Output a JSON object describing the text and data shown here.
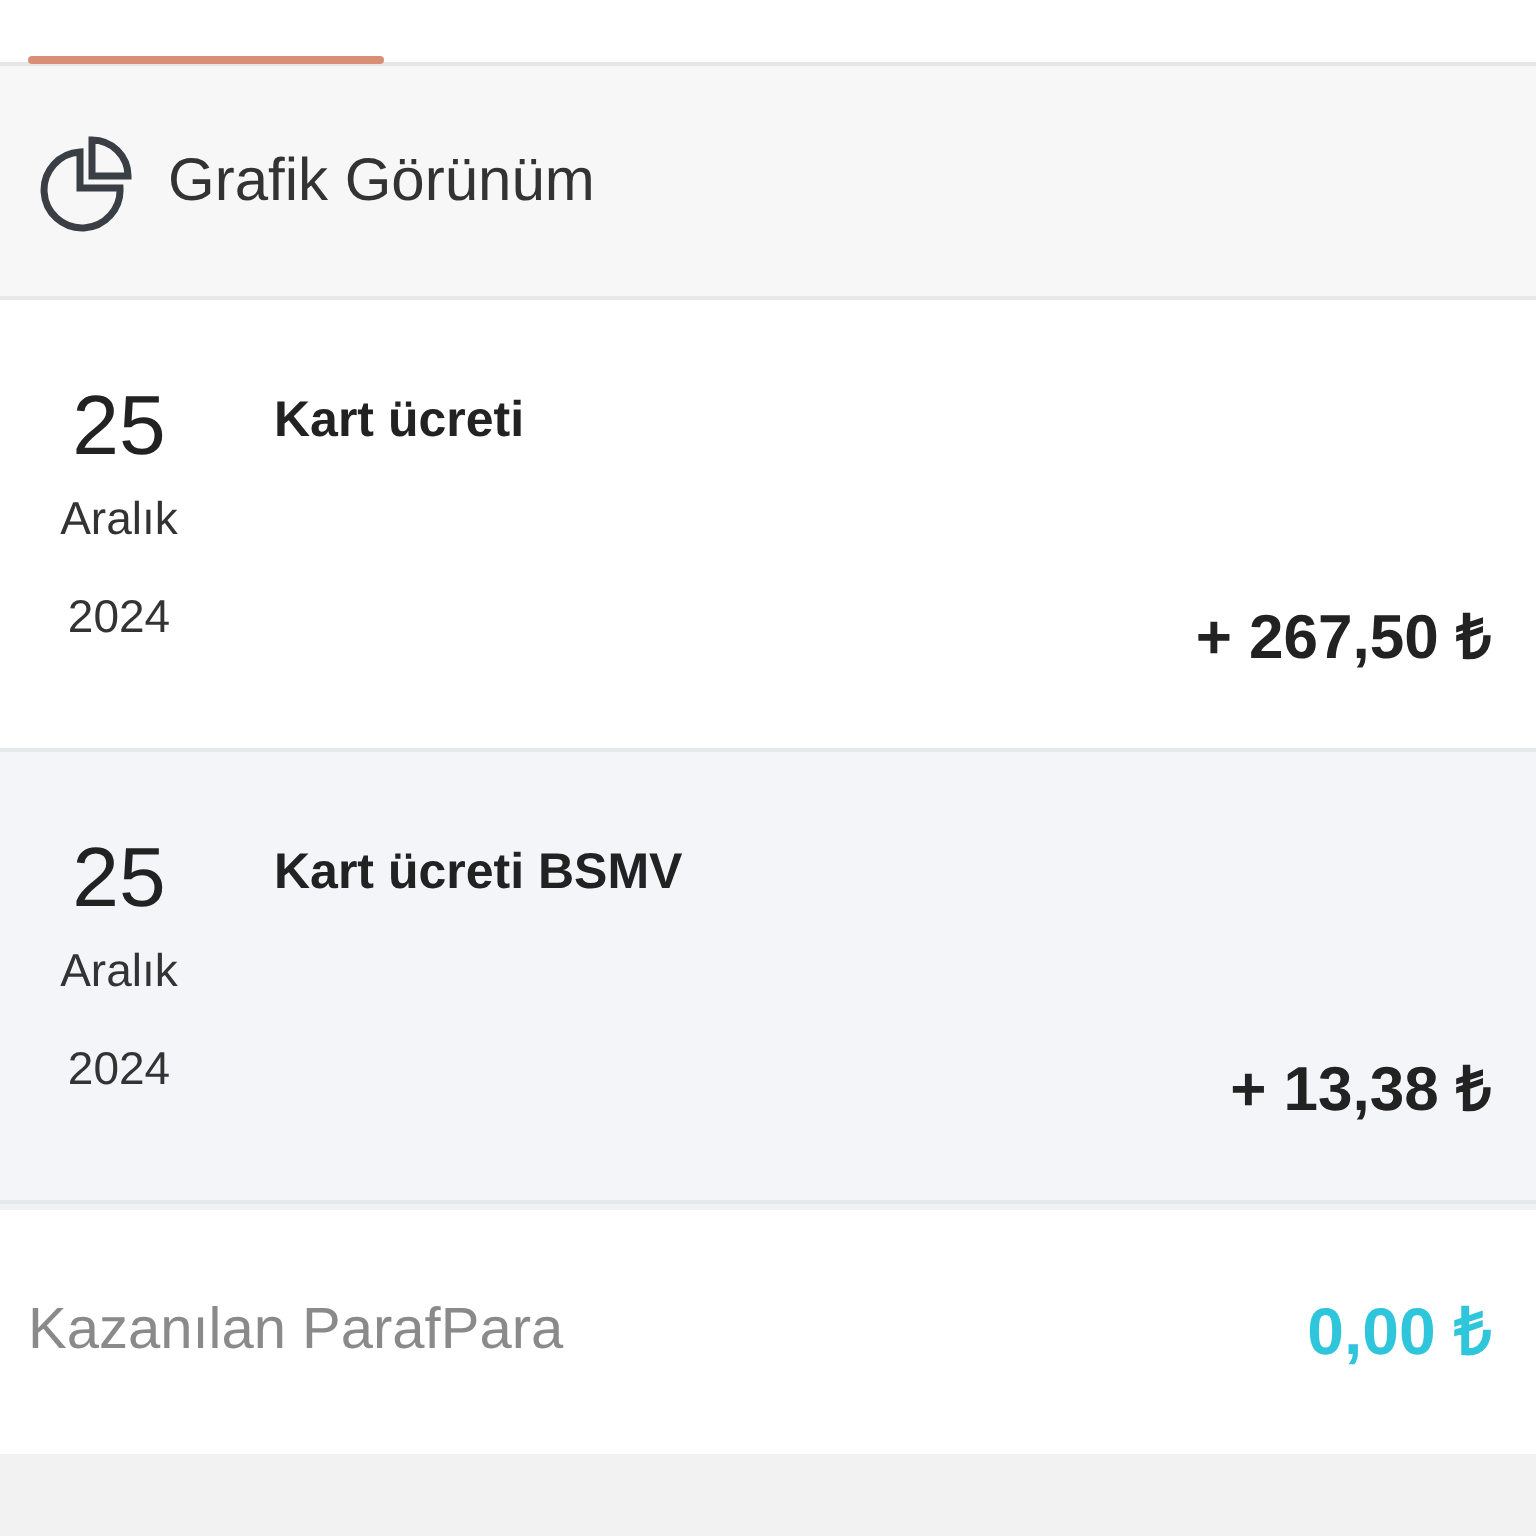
{
  "header": {
    "title": "Grafik Görünüm"
  },
  "transactions": [
    {
      "day": "25",
      "month": "Aralık",
      "year": "2024",
      "description": "Kart ücreti",
      "amount": "+ 267,50 ₺"
    },
    {
      "day": "25",
      "month": "Aralık",
      "year": "2024",
      "description": "Kart ücreti BSMV",
      "amount": "+ 13,38 ₺"
    }
  ],
  "earned": {
    "label": "Kazanılan ParafPara",
    "amount": "0,00 ₺"
  }
}
